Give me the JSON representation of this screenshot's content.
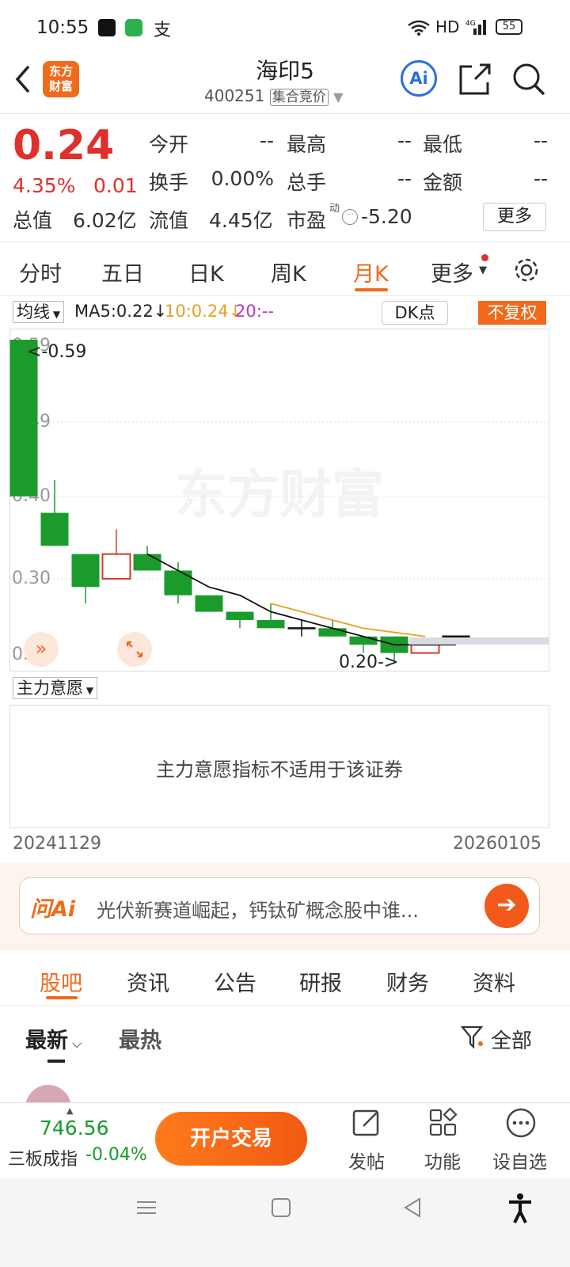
{
  "status_bar": {
    "time": "10:55",
    "network": "HD",
    "battery": "55"
  },
  "header": {
    "logo_text": [
      "东方",
      "财富"
    ],
    "title": "海印5",
    "code": "400251",
    "tag": "集合竞价",
    "ai_label": "Ai"
  },
  "quote": {
    "price": "0.24",
    "change_pct": "4.35%",
    "change": "0.01",
    "fields": [
      {
        "label": "今开",
        "value": "--"
      },
      {
        "label": "最高",
        "value": "--"
      },
      {
        "label": "最低",
        "value": "--"
      },
      {
        "label": "换手",
        "value": "0.00%"
      },
      {
        "label": "总手",
        "value": "--"
      },
      {
        "label": "金额",
        "value": "--"
      }
    ],
    "market_cap_label": "总值",
    "market_cap": "6.02亿",
    "float_label": "流值",
    "float_cap": "4.45亿",
    "pe_label": "市盈",
    "pe_sup": "动",
    "pe_value": "-5.20",
    "more_button": "更多"
  },
  "chart_tabs": [
    {
      "label": "分时",
      "active": false
    },
    {
      "label": "五日",
      "active": false
    },
    {
      "label": "日K",
      "active": false
    },
    {
      "label": "周K",
      "active": false
    },
    {
      "label": "月K",
      "active": true
    },
    {
      "label": "更多",
      "active": false
    }
  ],
  "ma_bar": {
    "selector": "均线",
    "ma5": "MA5:0.22↓",
    "ma10": "10:0.24↓",
    "ma20": "20:--",
    "dk": "DK点",
    "adjust": "不复权"
  },
  "chart_data": {
    "type": "candlestick",
    "y_ticks": [
      "0.59",
      "0.49",
      "0.40",
      "0.30",
      "0.20"
    ],
    "ylim": [
      0.2,
      0.59
    ],
    "high_label": "<-0.59",
    "low_label": "0.20->",
    "watermark": "东方财富",
    "candles": [
      {
        "o": 0.59,
        "c": 0.4,
        "h": 0.59,
        "l": 0.4
      },
      {
        "o": 0.38,
        "c": 0.34,
        "h": 0.42,
        "l": 0.34
      },
      {
        "o": 0.33,
        "c": 0.29,
        "h": 0.33,
        "l": 0.27
      },
      {
        "o": 0.3,
        "c": 0.33,
        "h": 0.36,
        "l": 0.3
      },
      {
        "o": 0.33,
        "c": 0.31,
        "h": 0.34,
        "l": 0.31
      },
      {
        "o": 0.31,
        "c": 0.28,
        "h": 0.32,
        "l": 0.27
      },
      {
        "o": 0.28,
        "c": 0.26,
        "h": 0.28,
        "l": 0.26
      },
      {
        "o": 0.26,
        "c": 0.25,
        "h": 0.26,
        "l": 0.24
      },
      {
        "o": 0.25,
        "c": 0.24,
        "h": 0.27,
        "l": 0.24
      },
      {
        "o": 0.24,
        "c": 0.24,
        "h": 0.25,
        "l": 0.23
      },
      {
        "o": 0.24,
        "c": 0.23,
        "h": 0.25,
        "l": 0.23
      },
      {
        "o": 0.23,
        "c": 0.22,
        "h": 0.23,
        "l": 0.21
      },
      {
        "o": 0.23,
        "c": 0.21,
        "h": 0.23,
        "l": 0.2
      },
      {
        "o": 0.21,
        "c": 0.22,
        "h": 0.22,
        "l": 0.21
      },
      {
        "o": 0.23,
        "c": 0.23,
        "h": 0.23,
        "l": 0.23
      }
    ],
    "ma5": [
      null,
      null,
      null,
      null,
      0.33,
      0.31,
      0.29,
      0.28,
      0.26,
      0.25,
      0.24,
      0.23,
      0.22,
      0.22,
      0.22
    ],
    "ma10": [
      null,
      null,
      null,
      null,
      null,
      null,
      null,
      null,
      0.27,
      0.26,
      0.25,
      0.24,
      0.235,
      0.23,
      null
    ],
    "colors": {
      "down": "#1a9b2c",
      "up": "#d63a2f",
      "ma5": "#111111",
      "ma10": "#e8a020"
    }
  },
  "indicator": {
    "selector": "主力意愿",
    "message": "主力意愿指标不适用于该证券"
  },
  "date_range": {
    "start": "20241129",
    "end": "20260105"
  },
  "ai_search": {
    "brand": "问Ai",
    "text": "光伏新赛道崛起，钙钛矿概念股中谁..."
  },
  "content_tabs": [
    {
      "label": "股吧",
      "active": true
    },
    {
      "label": "资讯",
      "active": false
    },
    {
      "label": "公告",
      "active": false
    },
    {
      "label": "研报",
      "active": false
    },
    {
      "label": "财务",
      "active": false
    },
    {
      "label": "资料",
      "active": false
    }
  ],
  "sort": {
    "latest": "最新",
    "hot": "最热",
    "filter": "全部"
  },
  "bottom_bar": {
    "index_value": "746.56",
    "index_name": "三板成指",
    "index_change": "-0.04%",
    "trade_button": "开户交易",
    "actions": [
      "发帖",
      "功能",
      "设自选"
    ]
  }
}
